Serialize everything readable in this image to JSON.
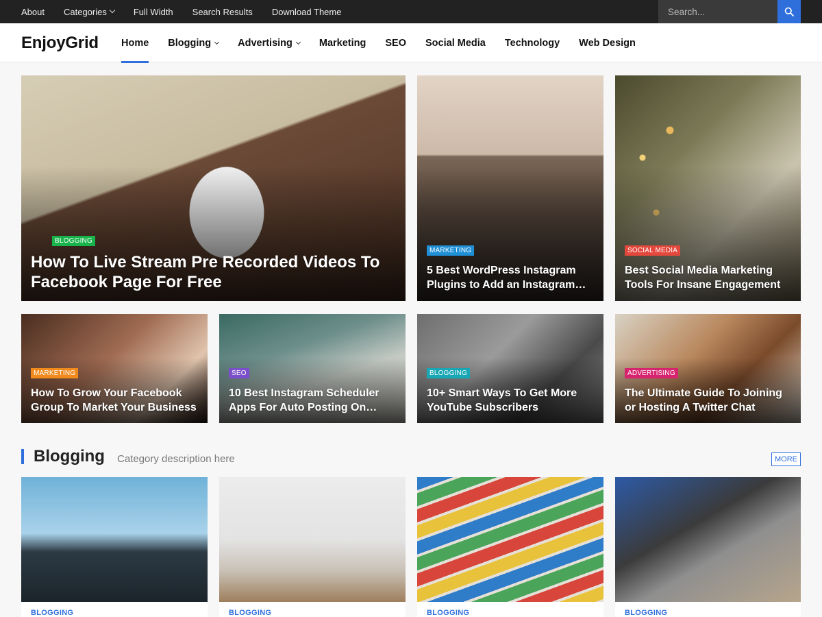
{
  "topbar": {
    "links": [
      "About",
      "Categories",
      "Full Width",
      "Search Results",
      "Download Theme"
    ],
    "search_placeholder": "Search..."
  },
  "header": {
    "logo": "EnjoyGrid",
    "nav": [
      "Home",
      "Blogging",
      "Advertising",
      "Marketing",
      "SEO",
      "Social Media",
      "Technology",
      "Web Design"
    ],
    "active": "Home"
  },
  "featured": [
    {
      "category": "BLOGGING",
      "title": "How To Live Stream Pre Recorded Videos To Facebook Page For Free",
      "cat_color": "#19b34c"
    },
    {
      "category": "MARKETING",
      "title": "5 Best WordPress Instagram Plugins to Add an Instagram…",
      "cat_color": "#1f8fd6"
    },
    {
      "category": "SOCIAL MEDIA",
      "title": "Best Social Media Marketing Tools For Insane Engagement",
      "cat_color": "#e4483d"
    },
    {
      "category": "MARKETING",
      "title": "How To Grow Your Facebook Group To Market Your Business",
      "cat_color": "#f08a1c"
    },
    {
      "category": "SEO",
      "title": "10 Best Instagram Scheduler Apps For Auto Posting On…",
      "cat_color": "#7b4fc9"
    },
    {
      "category": "BLOGGING",
      "title": "10+ Smart Ways To Get More YouTube Subscribers",
      "cat_color": "#18a7b5"
    },
    {
      "category": "ADVERTISING",
      "title": "The Ultimate Guide To Joining or Hosting A Twitter Chat",
      "cat_color": "#d6246e"
    }
  ],
  "section": {
    "title": "Blogging",
    "description": "Category description here",
    "more": "MORE",
    "cards": [
      "BLOGGING",
      "BLOGGING",
      "BLOGGING",
      "BLOGGING"
    ]
  },
  "colors": {
    "accent": "#2f6fdc",
    "topbar": "#222222"
  }
}
